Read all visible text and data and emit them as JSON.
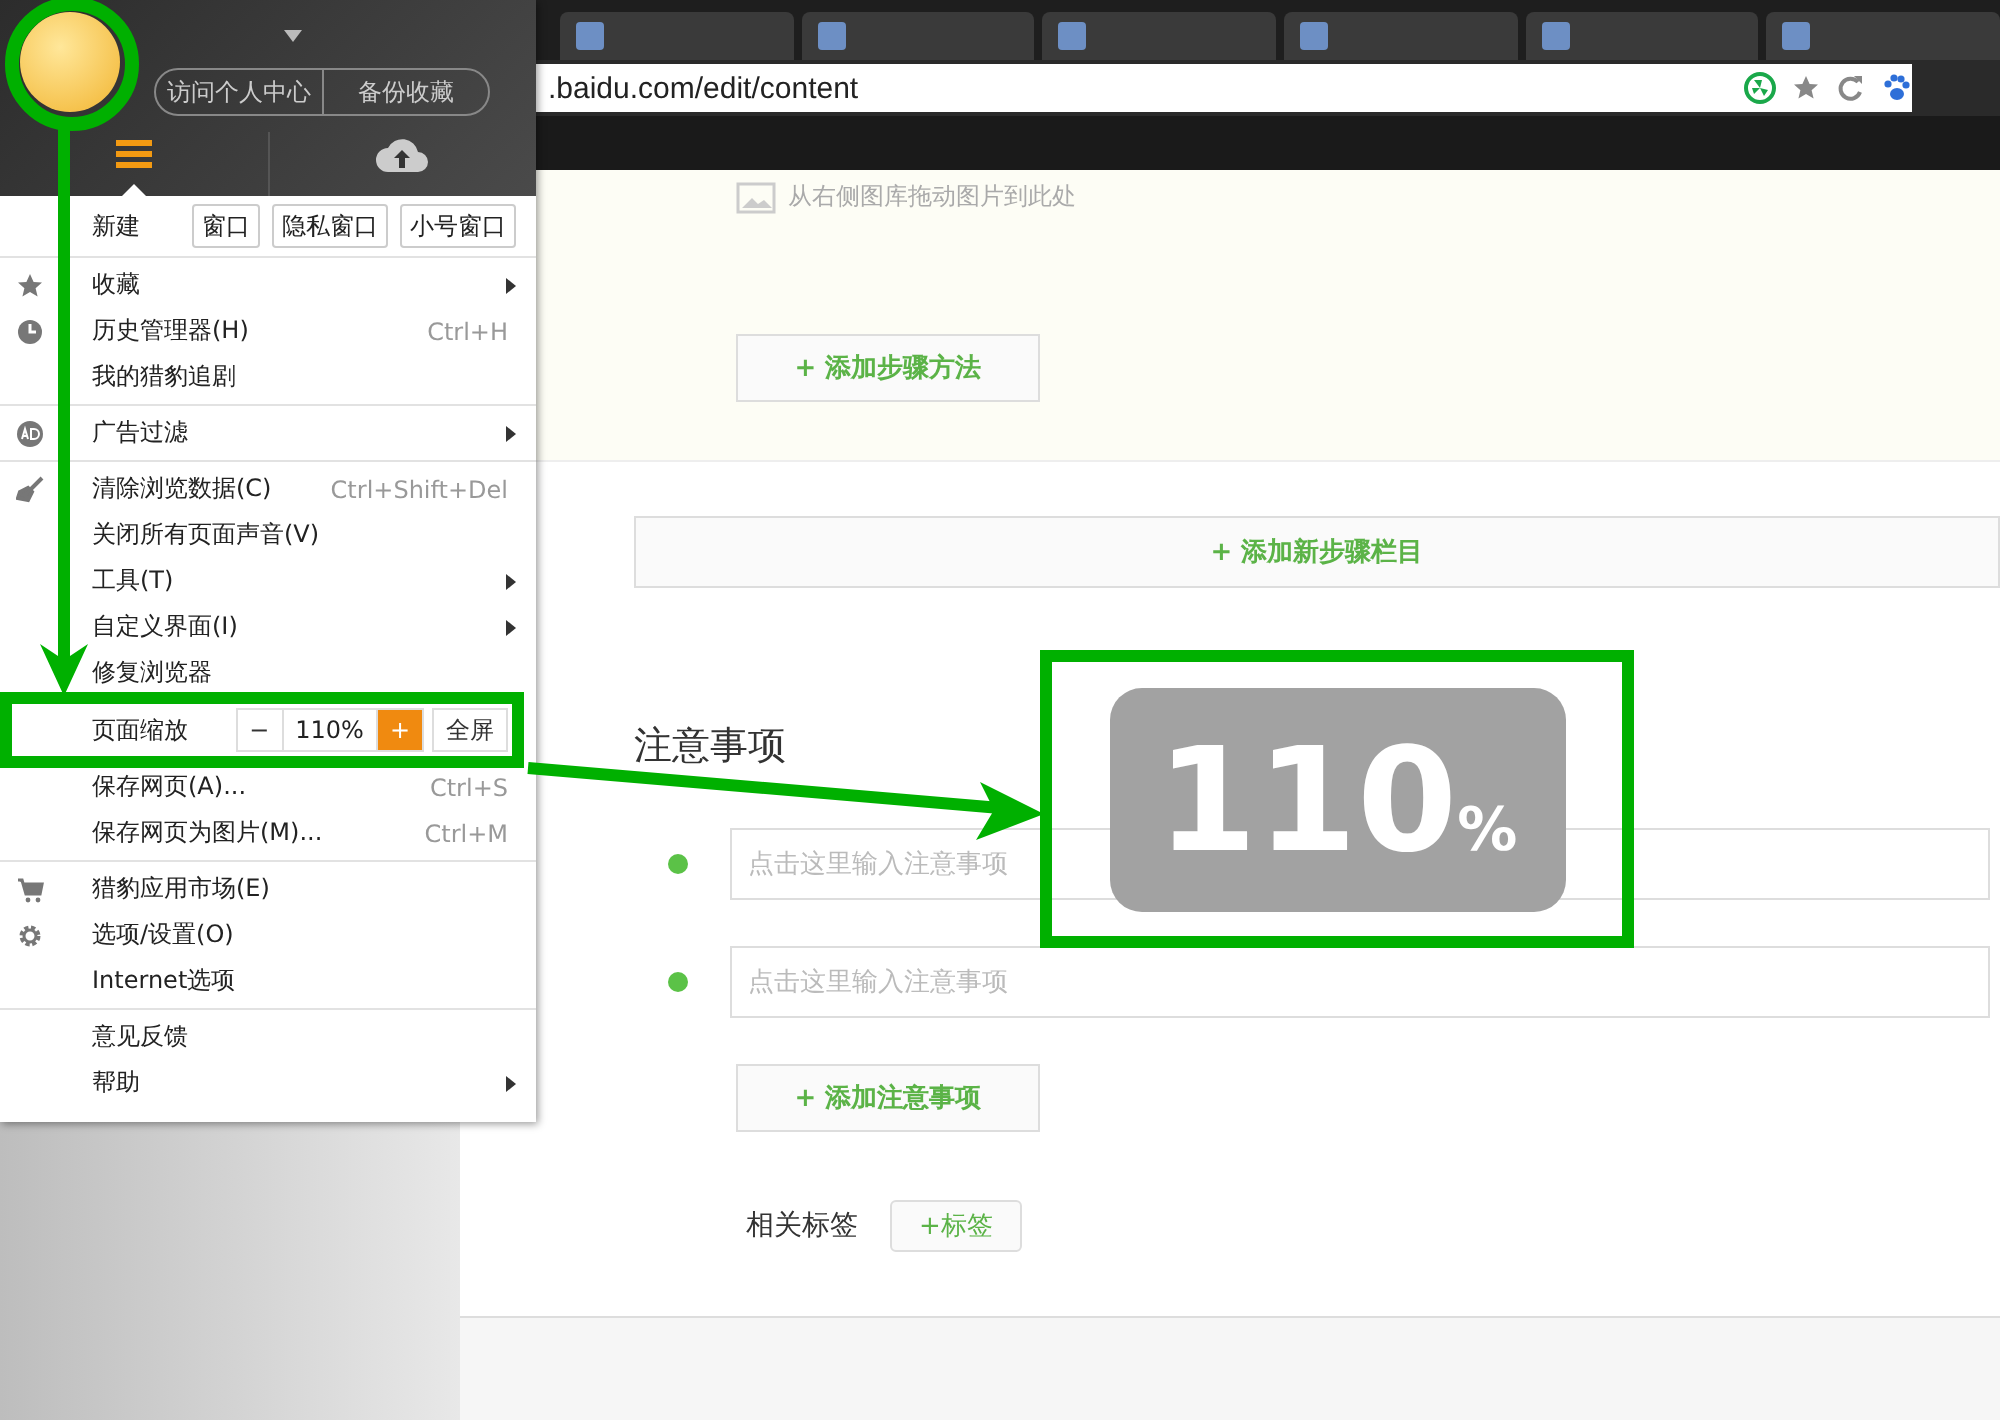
{
  "browser": {
    "address": ".baidu.com/edit/content"
  },
  "page": {
    "drop_hint": "从右侧图库拖动图片到此处",
    "add_step_button": "+ 添加步骤方法",
    "add_section_button": "+ 添加新步骤栏目",
    "notes_heading": "注意事项",
    "notes": [
      {
        "placeholder": "点击这里输入注意事项"
      },
      {
        "placeholder": "点击这里输入注意事项"
      }
    ],
    "add_note_button": "+ 添加注意事项",
    "tags_label": "相关标签",
    "add_tag_button": "+标签"
  },
  "menu": {
    "profile_buttons": [
      "访问个人中心",
      "备份收藏"
    ],
    "tabs": [
      {
        "kind": "menu",
        "selected": true
      },
      {
        "kind": "cloud",
        "selected": false
      }
    ],
    "new_label": "新建",
    "new_buttons": [
      "窗口",
      "隐私窗口",
      "小号窗口"
    ],
    "groups": [
      [
        {
          "kind": "star",
          "label": "收藏",
          "submenu": true
        },
        {
          "kind": "clock",
          "label": "历史管理器(H)",
          "shortcut": "Ctrl+H",
          "submenu": false
        },
        {
          "kind": "plain",
          "label": "我的猎豹追剧",
          "submenu": false
        }
      ],
      [
        {
          "kind": "ad",
          "label": "广告过滤",
          "submenu": true
        }
      ],
      [
        {
          "kind": "broom",
          "label": "清除浏览数据(C)",
          "shortcut": "Ctrl+Shift+Del",
          "submenu": false
        },
        {
          "kind": "plain",
          "label": "关闭所有页面声音(V)",
          "submenu": false
        },
        {
          "kind": "plain",
          "label": "工具(T)",
          "submenu": true
        },
        {
          "kind": "plain",
          "label": "自定义界面(I)",
          "submenu": true
        },
        {
          "kind": "plain",
          "label": "修复浏览器",
          "submenu": false
        },
        {
          "kind": "zoom",
          "label": "页面缩放",
          "minus": "−",
          "value": "110%",
          "plus": "+",
          "fullscreen": "全屏"
        },
        {
          "kind": "plain",
          "label": "保存网页(A)...",
          "shortcut": "Ctrl+S",
          "submenu": false
        },
        {
          "kind": "plain",
          "label": "保存网页为图片(M)...",
          "shortcut": "Ctrl+M",
          "submenu": false
        }
      ],
      [
        {
          "kind": "cart",
          "label": "猎豹应用市场(E)",
          "submenu": false
        },
        {
          "kind": "gear",
          "label": "选项/设置(O)",
          "submenu": false
        },
        {
          "kind": "plain",
          "label": "Internet选项",
          "submenu": false
        }
      ],
      [
        {
          "kind": "plain",
          "label": "意见反馈",
          "submenu": false
        },
        {
          "kind": "plain",
          "label": "帮助",
          "submenu": true
        }
      ]
    ]
  },
  "callout": {
    "value": "110",
    "unit": "%"
  }
}
